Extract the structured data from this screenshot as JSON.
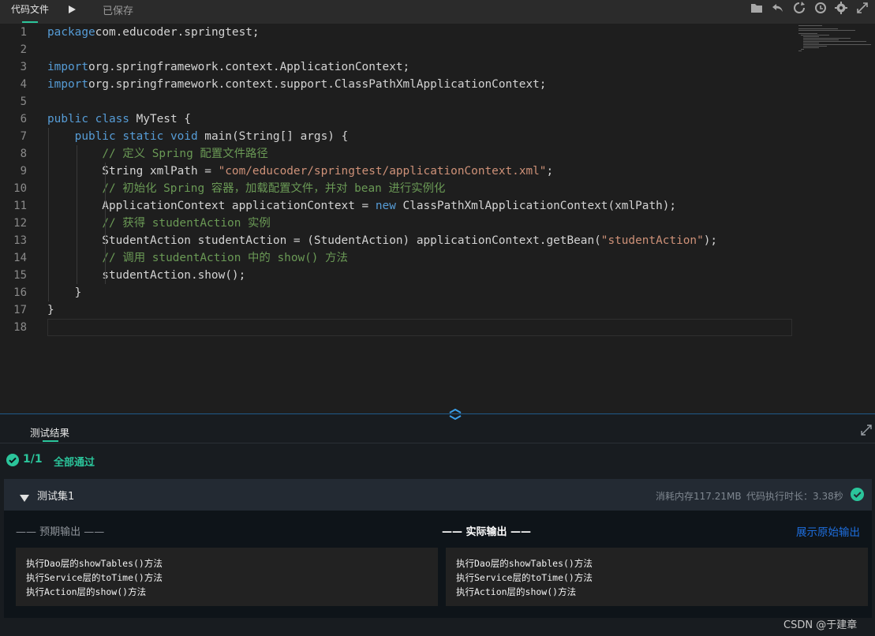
{
  "toolbar": {
    "file_tab": "代码文件",
    "saved_status": "已保存",
    "icons": [
      "folder-icon",
      "undo-icon",
      "refresh-icon",
      "history-icon",
      "gear-icon",
      "fullscreen-icon"
    ]
  },
  "editor": {
    "line_numbers": [
      "1",
      "2",
      "3",
      "4",
      "5",
      "6",
      "7",
      "8",
      "9",
      "10",
      "11",
      "12",
      "13",
      "14",
      "15",
      "16",
      "17",
      "18"
    ],
    "lines": [
      [
        [
          "kw",
          "package"
        ],
        [
          "",
          "com.educoder.springtest;"
        ]
      ],
      [],
      [
        [
          "kw",
          "import"
        ],
        [
          "",
          "org.springframework.context.ApplicationContext;"
        ]
      ],
      [
        [
          "kw",
          "import"
        ],
        [
          "",
          "org.springframework.context.support.ClassPathXmlApplicationContext;"
        ]
      ],
      [],
      [
        [
          "kw",
          "public"
        ],
        [
          "",
          " "
        ],
        [
          "kw",
          "class"
        ],
        [
          "",
          " MyTest {"
        ]
      ],
      [
        [
          "",
          "    "
        ],
        [
          "kw",
          "public"
        ],
        [
          "",
          " "
        ],
        [
          "kw",
          "static"
        ],
        [
          "",
          " "
        ],
        [
          "kw",
          "void"
        ],
        [
          "",
          " main(String[] args) {"
        ]
      ],
      [
        [
          "",
          "        "
        ],
        [
          "cm",
          "// 定义 Spring 配置文件路径"
        ]
      ],
      [
        [
          "",
          "        String xmlPath = "
        ],
        [
          "str",
          "\"com/educoder/springtest/applicationContext.xml\""
        ],
        [
          "",
          ";"
        ]
      ],
      [
        [
          "",
          "        "
        ],
        [
          "cm",
          "// 初始化 Spring 容器，加载配置文件，并对 bean 进行实例化"
        ]
      ],
      [
        [
          "",
          "        ApplicationContext applicationContext = "
        ],
        [
          "kw",
          "new"
        ],
        [
          "",
          " ClassPathXmlApplicationContext(xmlPath);"
        ]
      ],
      [
        [
          "",
          "        "
        ],
        [
          "cm",
          "// 获得 studentAction 实例"
        ]
      ],
      [
        [
          "",
          "        StudentAction studentAction = (StudentAction) applicationContext.getBean("
        ],
        [
          "str",
          "\"studentAction\""
        ],
        [
          "",
          ");"
        ]
      ],
      [
        [
          "",
          "        "
        ],
        [
          "cm",
          "// 调用 studentAction 中的 show() 方法"
        ]
      ],
      [
        [
          "",
          "        studentAction.show();"
        ]
      ],
      [
        [
          "",
          "    }"
        ]
      ],
      [
        [
          "",
          "}"
        ]
      ],
      []
    ]
  },
  "results": {
    "tab": "测试结果",
    "pass_count": "1/1",
    "pass_label": "全部通过",
    "suite": {
      "name": "测试集1",
      "memory": "消耗内存117.21MB",
      "duration": "代码执行时长：3.38秒",
      "expected_title": "—— 预期输出 ——",
      "actual_title": "—— 实际输出 ——",
      "raw_output_link": "展示原始输出",
      "expected_output": [
        "执行Dao层的showTables()方法",
        "执行Service层的toTime()方法",
        "执行Action层的show()方法"
      ],
      "actual_output": [
        "执行Dao层的showTables()方法",
        "执行Service层的toTime()方法",
        "执行Action层的show()方法"
      ]
    }
  },
  "watermark": "CSDN @于建章",
  "colors": {
    "accent": "#2bc59b",
    "keyword": "#569cd6",
    "comment": "#6a9955",
    "string": "#ce9178",
    "link": "#1e6fe0"
  }
}
